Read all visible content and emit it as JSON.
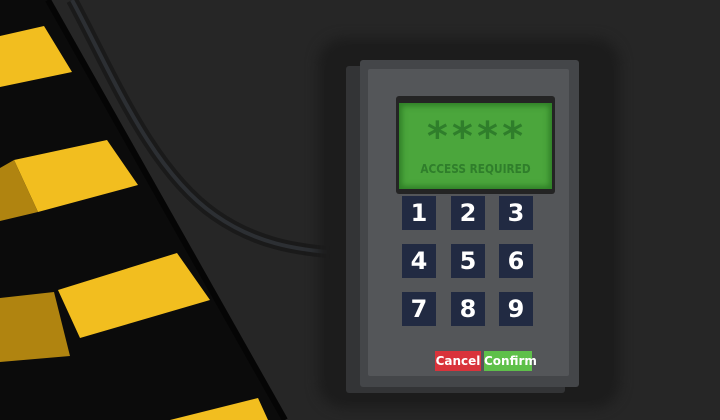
{
  "keypad": {
    "display": {
      "code": "****",
      "message": "ACCESS REQUIRED"
    },
    "keys": [
      "1",
      "2",
      "3",
      "4",
      "5",
      "6",
      "7",
      "8",
      "9"
    ],
    "cancel_label": "Cancel",
    "confirm_label": "Confirm"
  },
  "colors": {
    "background": "#262626",
    "keypad_body": "#545659",
    "screen_glow": "#4ba63c",
    "screen_text": "#2f7e2b",
    "key_background": "#212a42",
    "cancel": "#d9333b",
    "confirm": "#5ec04a",
    "hazard_yellow": "#f2be1f"
  }
}
